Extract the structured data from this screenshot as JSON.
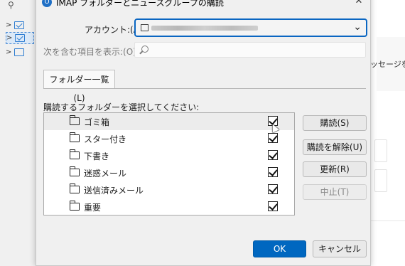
{
  "background": {
    "tree_items": [
      {
        "expanded": false,
        "icon": "mail-folder-icon"
      },
      {
        "expanded": false,
        "icon": "mail-folder-icon",
        "selected": true
      },
      {
        "expanded": false,
        "icon": "folder-icon"
      }
    ],
    "right_text": "ッセージを"
  },
  "dialog": {
    "title": "IMAP フォルダーとニュースグループの購読",
    "close": "✕",
    "account_label": "アカウント:(A)",
    "account_value": "",
    "filter_label": "次を含む項目を表示:(O)",
    "filter_value": "",
    "tab_label": "フォルダー一覧(L)",
    "list_caption": "購読するフォルダーを選択してください:",
    "folders": [
      {
        "name": "ゴミ箱",
        "checked": true
      },
      {
        "name": "スター付き",
        "checked": true
      },
      {
        "name": "下書き",
        "checked": true
      },
      {
        "name": "迷惑メール",
        "checked": true
      },
      {
        "name": "送信済みメール",
        "checked": true
      },
      {
        "name": "重要",
        "checked": true
      }
    ],
    "buttons": {
      "subscribe": "購読(S)",
      "unsubscribe": "購読を解除(U)",
      "refresh": "更新(R)",
      "stop": "中止(T)",
      "ok": "OK",
      "cancel": "キャンセル"
    }
  },
  "colors": {
    "accent": "#0067c0",
    "focus_border": "#0a66c2"
  }
}
